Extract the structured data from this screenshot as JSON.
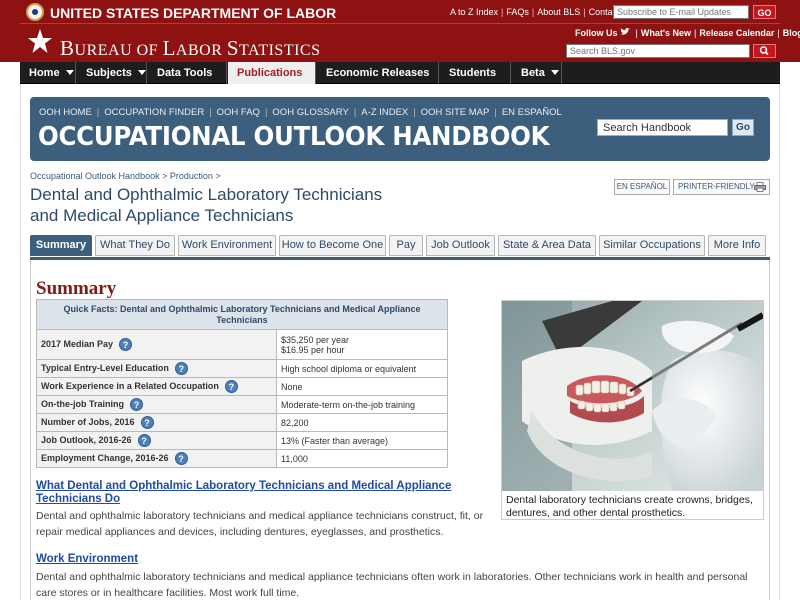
{
  "dol": {
    "name": "UNITED STATES DEPARTMENT OF LABOR"
  },
  "util_links": [
    "A to Z Index",
    "FAQs",
    "About BLS",
    "Contact Us"
  ],
  "email": {
    "placeholder": "Subscribe to E-mail Updates",
    "go_label": "GO"
  },
  "bls": {
    "logo_text_first": "B",
    "logo_text_rest": "UREAU OF ",
    "logo_l": "L",
    "logo_abor": "ABOR ",
    "logo_s": "S",
    "logo_tatistics": "TATISTICS"
  },
  "social": {
    "follow": "Follow Us",
    "whats_new": "What's New",
    "release_calendar": "Release Calendar",
    "blog": "Blog"
  },
  "bls_search": {
    "placeholder": "Search BLS.gov"
  },
  "nav": [
    {
      "label": "Home"
    },
    {
      "label": "Subjects"
    },
    {
      "label": "Data Tools"
    },
    {
      "label": "Publications"
    },
    {
      "label": "Economic Releases"
    },
    {
      "label": "Students"
    },
    {
      "label": "Beta"
    }
  ],
  "ooh": {
    "links": [
      "OOH HOME",
      "OCCUPATION FINDER",
      "OOH FAQ",
      "OOH GLOSSARY",
      "A-Z INDEX",
      "OOH SITE MAP",
      "EN ESPAÑOL"
    ],
    "title": "OCCUPATIONAL OUTLOOK HANDBOOK",
    "search_value": "Search Handbook",
    "go_label": "Go"
  },
  "breadcrumb": {
    "root": "Occupational Outlook Handbook",
    "sep": " > ",
    "section": "Production",
    "trail": " >"
  },
  "page": {
    "title_line1": "Dental and Ophthalmic Laboratory Technicians",
    "title_line2": "and Medical Appliance Technicians",
    "en_espanol": "EN ESPAÑOL",
    "printer_friendly": "PRINTER-FRIENDLY"
  },
  "tabs": [
    "Summary",
    "What They Do",
    "Work Environment",
    "How to Become One",
    "Pay",
    "Job Outlook",
    "State & Area Data",
    "Similar Occupations",
    "More Info"
  ],
  "summary": {
    "heading": "Summary",
    "table_title": "Quick Facts: Dental and Ophthalmic Laboratory Technicians and Medical Appliance Technicians",
    "rows": [
      {
        "label": "2017 Median Pay",
        "value_line1": "$35,250 per year",
        "value_line2": "$16.95 per hour"
      },
      {
        "label": "Typical Entry-Level Education",
        "value": "High school diploma or equivalent"
      },
      {
        "label": "Work Experience in a Related Occupation",
        "value": "None"
      },
      {
        "label": "On-the-job Training",
        "value": "Moderate-term on-the-job training"
      },
      {
        "label": "Number of Jobs, 2016",
        "value": "82,200"
      },
      {
        "label": "Job Outlook, 2016-26",
        "value": "13% (Faster than average)"
      },
      {
        "label": "Employment Change, 2016-26",
        "value": "11,000"
      }
    ],
    "help_glyph": "?"
  },
  "photo": {
    "caption": "Dental laboratory technicians create crowns, bridges, dentures, and other dental prosthetics."
  },
  "sections": {
    "what_they_do": {
      "heading": "What Dental and Ophthalmic Laboratory Technicians and Medical Appliance Technicians Do",
      "text": "Dental and ophthalmic laboratory technicians and medical appliance technicians construct, fit, or repair medical appliances and devices, including dentures, eyeglasses, and prosthetics."
    },
    "work_environment": {
      "heading": "Work Environment",
      "text": "Dental and ophthalmic laboratory technicians and medical appliance technicians often work in laboratories. Other technicians work in health and personal care stores or in healthcare facilities. Most work full time."
    }
  },
  "icons": {
    "seal": "dol-seal-icon",
    "star": "bls-star-icon",
    "bird": "twitter-bird-icon",
    "search": "search-icon",
    "printer": "printer-icon",
    "help": "help-icon"
  },
  "colors": {
    "banner_red": "#8e1212",
    "nav_dark": "#1d1d1d",
    "ooh_blue": "#3d5f7e",
    "link_blue": "#1f4aa8",
    "heading_maroon": "#7d1a1a"
  }
}
